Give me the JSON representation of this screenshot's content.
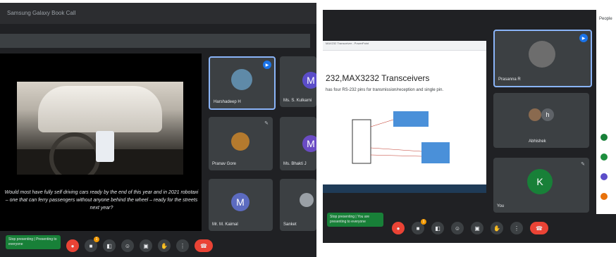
{
  "left": {
    "topbar_title": "Samsung Galaxy Book Call",
    "caption": "Would most have fully self driving cars ready by the end of this year and in 2021 robotaxi – one that can ferry passengers without anyone behind the wheel – ready for the streets next year?",
    "tiles": [
      {
        "name": "Harshadeep H"
      },
      {
        "name": "Ms. S. Kulkarni",
        "initial": "M"
      },
      {
        "name": "Pranav Gore"
      },
      {
        "name": "Ms. Bhakti J",
        "initial": "M"
      },
      {
        "name": "Mr. M. Kaimal",
        "initial": "M"
      },
      {
        "name": "Sanket"
      }
    ],
    "present_text": "Stop presenting | Presenting to everyone",
    "colors": {
      "panel": "#202124",
      "tile": "#3c4043",
      "accent": "#8ab4f8"
    }
  },
  "right": {
    "slide_title": "232,MAX3232 Transceivers",
    "slide_text": "has four RS-232 pins for transmission/reception and single pin.",
    "winbar": "MAX232 Transceiver - PowerPoint",
    "tiles": [
      {
        "name": "Prasanna R"
      },
      {
        "name": "Abhishek"
      },
      {
        "name": "You",
        "initial": "K"
      }
    ],
    "side_title": "People",
    "present_text": "Stop presenting | You are presenting to everyone",
    "colors": {
      "panel": "#202124",
      "hang": "#ea4335",
      "present": "#188038"
    }
  },
  "controls": {
    "mic_icon": "mic-off-icon",
    "notification_count": "1",
    "icons": [
      "mic-off-icon",
      "notification-icon",
      "captions-icon",
      "emoji-icon",
      "present-icon",
      "raise-hand-icon",
      "more-icon",
      "hang-up-icon"
    ]
  }
}
